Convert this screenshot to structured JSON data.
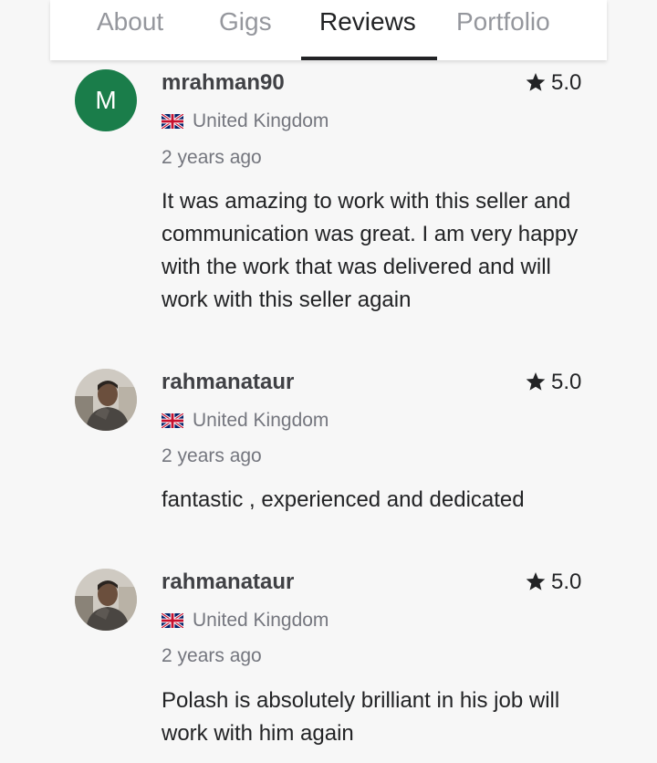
{
  "tabs": {
    "about": "About",
    "gigs": "Gigs",
    "reviews": "Reviews",
    "portfolio": "Portfolio",
    "active": "Reviews"
  },
  "colors": {
    "avatar_green": "#1a7d4a",
    "active_tab": "#222325",
    "inactive_tab": "#95979d"
  },
  "reviews": [
    {
      "avatar_letter": "M",
      "username": "mrahman90",
      "rating": "5.0",
      "country": "United Kingdom",
      "time": "2 years ago",
      "text": "It was amazing to work with this seller and communication was great. I am very happy with the work that was delivered and will work with this seller again"
    },
    {
      "avatar_letter": "",
      "username": "rahmanataur",
      "rating": "5.0",
      "country": "United Kingdom",
      "time": "2 years ago",
      "text": "fantastic , experienced and dedicated"
    },
    {
      "avatar_letter": "",
      "username": "rahmanataur",
      "rating": "5.0",
      "country": "United Kingdom",
      "time": "2 years ago",
      "text": "Polash is absolutely brilliant in his job will work with him again"
    }
  ]
}
